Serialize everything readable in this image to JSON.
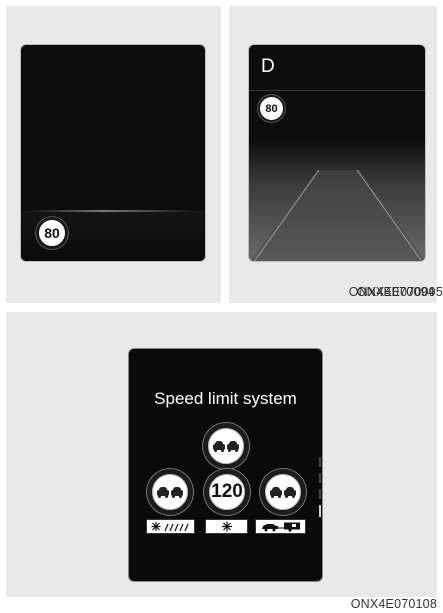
{
  "figures": [
    {
      "caption": "ONX4E070094",
      "speed_sign": "80"
    },
    {
      "caption": "ONX4E070095",
      "gear": "D",
      "speed_sign": "80"
    },
    {
      "caption": "ONX4E070108",
      "title": "Speed limit system",
      "center_sign": "120",
      "supplementary_plates": [
        "snow-rain-icon",
        "snowflake-icon",
        "car-trailer-icon"
      ]
    }
  ]
}
